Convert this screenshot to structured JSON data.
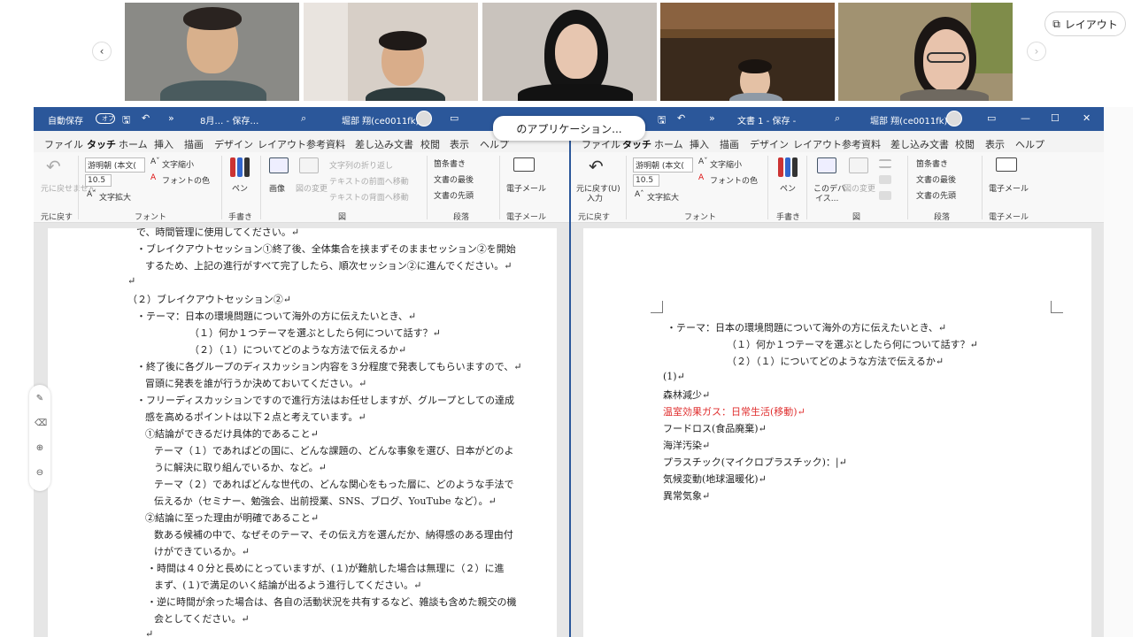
{
  "meeting": {
    "layout_label": "レイアウト",
    "share_tooltip": "のアプリケーション...",
    "tiles": [
      {
        "name": "participant-1",
        "bg": "#8a8a86",
        "skin": "#d8b08c",
        "shirt": "#4a5b5e"
      },
      {
        "name": "participant-2",
        "bg": "#d7cfc7",
        "skin": "#d9ad8a",
        "shirt": "#2c3a3c"
      },
      {
        "name": "participant-3",
        "bg": "#c9c3bd",
        "skin": "#e7c6b0",
        "shirt": "#121212"
      },
      {
        "name": "participant-4",
        "bg": "#6a4a2a",
        "skin": "#e4c1a5",
        "shirt": "#8f9aa6"
      },
      {
        "name": "participant-5",
        "bg": "#a19271",
        "skin": "#e8c3ac",
        "shirt": "#6f6960"
      }
    ]
  },
  "left_window": {
    "autosave_label": "自動保存",
    "autosave_state": "オフ",
    "doc_title": "8月… - 保存…",
    "user": "堀部 翔(ce0011fk)",
    "tabs": [
      "ファイル",
      "タッチ",
      "ホーム",
      "挿入",
      "描画",
      "デザイン",
      "レイアウト",
      "参考資料",
      "差し込み文書",
      "校閲",
      "表示",
      "ヘルプ"
    ],
    "ribbon": {
      "undo": "元に戻せません",
      "undo_group": "元に戻す",
      "font_name": "游明朝 (本文(",
      "font_size": "10.5",
      "shrink": "文字縮小",
      "grow": "文字拡大",
      "font_color": "フォントの色",
      "font_group": "フォント",
      "pen": "ペン",
      "handwriting_group": "手書き",
      "image": "画像",
      "change_image": "図の変更",
      "wrap": "文字列の折り返し",
      "front": "テキストの前面へ移動",
      "back": "テキストの背面へ移動",
      "figure_group": "図",
      "bullets": "箇条書き",
      "doc_end": "文書の最後",
      "doc_start": "文書の先頭",
      "paragraph_group": "段落",
      "email": "電子メール",
      "email_group": "電子メール"
    },
    "lines": [
      "で、時間管理に使用してください。↵",
      "・ブレイクアウトセッション①終了後、全体集合を挟まずそのままセッション②を開始",
      "するため、上記の進行がすべて完了したら、順次セッション②に進んでください。↵",
      "↵",
      "（２）ブレイクアウトセッション②↵",
      "・テーマ：日本の環境問題について海外の方に伝えたいとき、↵",
      "（１）何か１つテーマを選ぶとしたら何について話す？↵",
      "（２）（１）についてどのような方法で伝えるか↵",
      "・終了後に各グループのディスカッション内容を３分程度で発表してもらいますので、↵",
      "冒頭に発表を誰が行うか決めておいてください。↵",
      "・フリーディスカッションですので進行方法はお任せしますが、グループとしての達成",
      "感を高めるポイントは以下２点と考えています。↵",
      "①結論ができるだけ具体的であること↵",
      "テーマ（１）であればどの国に、どんな課題の、どんな事象を選び、日本がどのよ",
      "うに解決に取り組んでいるか、など。↵",
      "テーマ（２）であればどんな世代の、どんな関心をもった層に、どのような手法で",
      "伝えるか（セミナー、勉強会、出前授業、SNS、ブログ、YouTube など）。↵",
      "②結論に至った理由が明確であること↵",
      "数ある候補の中で、なぜそのテーマ、その伝え方を選んだか、納得感のある理由付",
      "けができているか。↵",
      "・時間は４０分と長めにとっていますが、(１)が難航した場合は無理に（２）に進",
      "まず、(１)で満足のいく結論が出るよう進行してください。↵",
      "・逆に時間が余った場合は、各自の活動状況を共有するなど、雑談も含めた親交の機",
      "会としてください。↵",
      "↵"
    ]
  },
  "right_window": {
    "doc_title": "文書 1 - 保存 -",
    "user": "堀部 翔(ce0011fk)",
    "tabs": [
      "ファイル",
      "タッチ",
      "ホーム",
      "挿入",
      "描画",
      "デザイン",
      "レイアウト",
      "参考資料",
      "差し込み文書",
      "校閲",
      "表示",
      "ヘルプ"
    ],
    "ribbon": {
      "undo": "元に戻す(U)",
      "undo2": "入力",
      "undo_group": "元に戻す",
      "font_name": "游明朝 (本文(",
      "font_size": "10.5",
      "shrink": "文字縮小",
      "grow": "文字拡大",
      "font_color": "フォントの色",
      "font_group": "フォント",
      "pen": "ペン",
      "handwriting_group": "手書き",
      "device": "このデバ",
      "device2": "イス...",
      "change_image": "図の変更",
      "figure_group": "図",
      "bullets": "箇条書き",
      "doc_end": "文書の最後",
      "doc_start": "文書の先頭",
      "paragraph_group": "段落",
      "email": "電子メール",
      "email_group": "電子メール"
    },
    "lines": [
      "・テーマ：日本の環境問題について海外の方に伝えたいとき、↵",
      "（１）何か１つテーマを選ぶとしたら何について話す？↵",
      "（２）（１）についてどのような方法で伝えるか↵",
      "(1)↵",
      "森林減少↵",
      "温室効果ガス：日常生活(移動)↵",
      "フードロス(食品廃棄)↵",
      "海洋汚染↵",
      "プラスチック(マイクロプラスチック)：|↵",
      "気候変動(地球温暖化)↵",
      "異常気象↵"
    ]
  }
}
